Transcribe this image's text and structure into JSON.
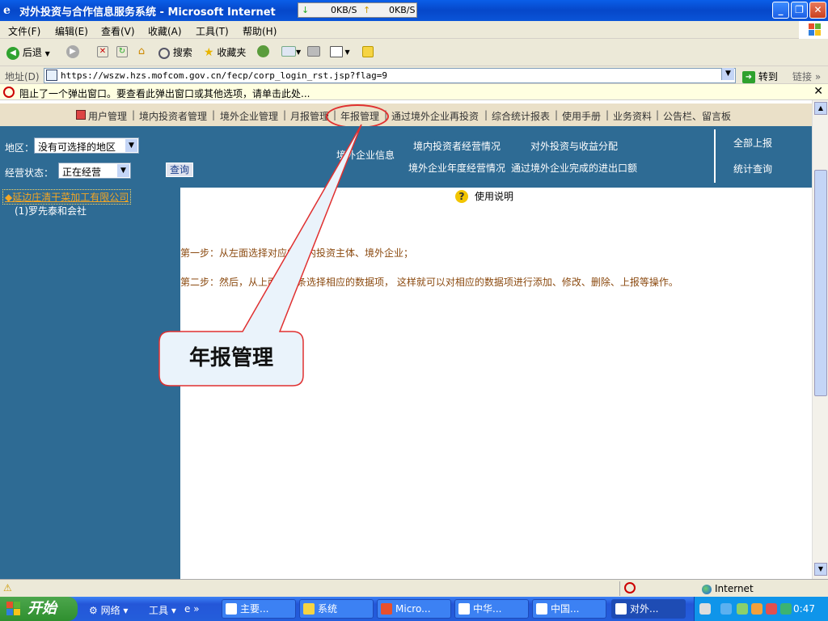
{
  "window": {
    "title": "对外投资与合作信息服务系统 - Microsoft Internet",
    "speed_down": "0KB/S",
    "speed_up": "0KB/S"
  },
  "menu": [
    "文件(F)",
    "编辑(E)",
    "查看(V)",
    "收藏(A)",
    "工具(T)",
    "帮助(H)"
  ],
  "toolbar": {
    "back": "后退",
    "search": "搜索",
    "favorites": "收藏夹"
  },
  "address": {
    "label": "地址(D)",
    "url": "https://wszw.hzs.mofcom.gov.cn/fecp/corp_login_rst.jsp?flag=9",
    "go": "转到",
    "links": "链接"
  },
  "popup": {
    "text": "阻止了一个弹出窗口。要查看此弹出窗口或其他选项，请单击此处..."
  },
  "nav": {
    "items": [
      "用户管理",
      "境内投资者管理",
      "境外企业管理",
      "月报管理",
      "年报管理",
      "通过境外企业再投资",
      "综合统计报表",
      "使用手册",
      "业务资料",
      "公告栏、留言板"
    ]
  },
  "filters": {
    "region_label": "地区：",
    "region_value": "没有可选择的地区",
    "status_label": "经营状态：",
    "status_value": "正在经营",
    "query_button": "查询"
  },
  "subnav": {
    "overseas_info": "境外企业信息",
    "domestic_ops": "境内投资者经营情况",
    "investment_income": "对外投资与收益分配",
    "annual_ops": "境外企业年度经营情况",
    "import_export": "通过境外企业完成的进出口额",
    "report_all": "全部上报",
    "stat_query": "统计查询"
  },
  "sidebar": {
    "company": "◆延边庄清干菜加工有限公司",
    "sub_item": "(1)罗先泰和会社"
  },
  "content": {
    "help": "使用说明",
    "step1": "第一步：从左面选择对应的境内投资主体、境外企业；",
    "step2": "第二步：然后，从上面导航条选择相应的数据项， 这样就可以对相应的数据项进行添加、修改、删除、上报等操作。"
  },
  "callout": {
    "text": "年报管理"
  },
  "status": {
    "zone": "Internet"
  },
  "taskbar": {
    "start": "开始",
    "quick": [
      "网络",
      "工具"
    ],
    "tasks": [
      "主要...",
      "系统",
      "Micro...",
      "中华...",
      "中国...",
      "对外..."
    ],
    "clock": "0:47"
  },
  "colors": {
    "accent_blue": "#2e6b94",
    "nav_bg": "#eae0c8",
    "callout_border": "#e03030"
  }
}
